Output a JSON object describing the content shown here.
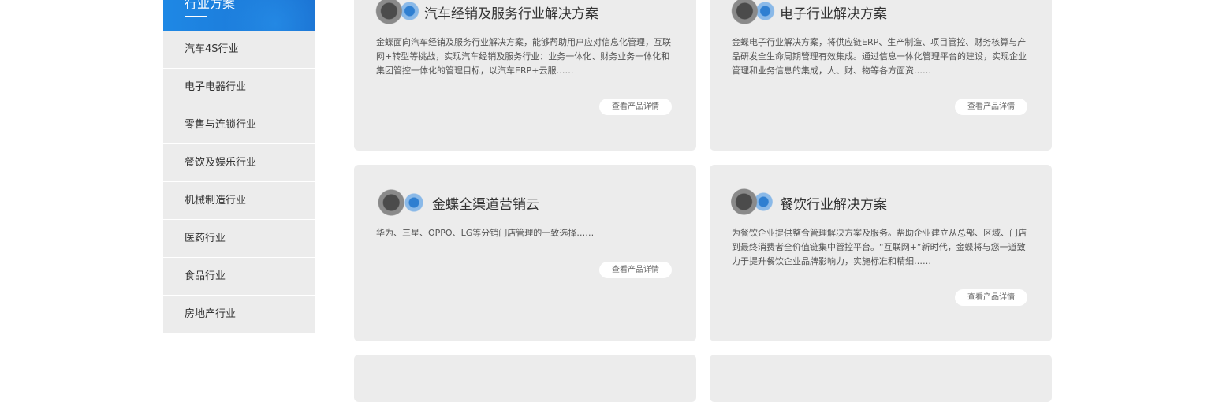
{
  "sidebar": {
    "title": "行业方案",
    "items": [
      {
        "label": "汽车4S行业"
      },
      {
        "label": "电子电器行业"
      },
      {
        "label": "零售与连锁行业"
      },
      {
        "label": "餐饮及娱乐行业"
      },
      {
        "label": "机械制造行业"
      },
      {
        "label": "医药行业"
      },
      {
        "label": "食品行业"
      },
      {
        "label": "房地产行业"
      }
    ]
  },
  "cards": [
    {
      "title": "汽车经销及服务行业解决方案",
      "desc": "金蝶面向汽车经销及服务行业解决方案，能够帮助用户应对信息化管理，互联网+转型等挑战，实现汽车经销及服务行业：业务一体化、财务业务一体化和集团管控一体化的管理目标，以汽车ERP+云服……",
      "button": "查看产品详情",
      "icon": "automotive-icon"
    },
    {
      "title": "电子行业解决方案",
      "desc": "金蝶电子行业解决方案，将供应链ERP、生产制造、项目管控、财务核算与产品研发全生命周期管理有效集成。通过信息一体化管理平台的建设，实现企业管理和业务信息的集成，人、财、物等各方面资……",
      "button": "查看产品详情",
      "icon": "electronics-icon"
    },
    {
      "title": "金蝶全渠道营销云",
      "desc": "华为、三星、OPPO、LG等分销门店管理的一致选择……",
      "button": "查看产品详情",
      "icon": "omnichannel-icon"
    },
    {
      "title": "餐饮行业解决方案",
      "desc": "为餐饮企业提供整合管理解决方案及服务。帮助企业建立从总部、区域、门店到最终消费者全价值链集中管控平台。“互联网+”新时代，金蝶将与您一道致力于提升餐饮企业品牌影响力，实施标准和精细……",
      "button": "查看产品详情",
      "icon": "catering-icon"
    }
  ]
}
